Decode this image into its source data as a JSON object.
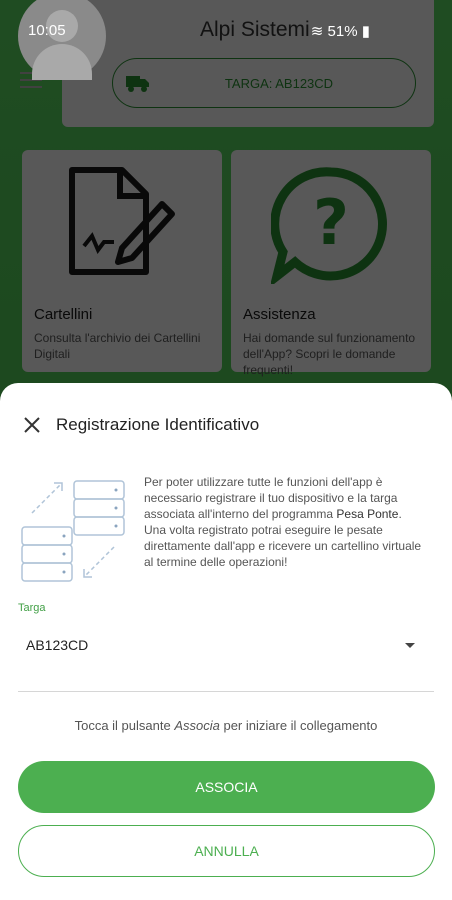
{
  "status_bar": {
    "time": "10:05",
    "battery": "51%"
  },
  "header": {
    "app_title": "Alpi Sistemi",
    "targa_label": "TARGA: AB123CD"
  },
  "cards": [
    {
      "title": "Cartellini",
      "description": "Consulta l'archivio dei Cartellini Digitali",
      "icon": "document-signature-icon"
    },
    {
      "title": "Assistenza",
      "description": "Hai domande sul funzionamento dell'App? Scopri le domande frequenti!",
      "icon": "question-bubble-icon"
    }
  ],
  "sheet": {
    "title": "Registrazione Identificativo",
    "info_text_1": "Per poter utilizzare tutte le funzioni dell'app è necessario registrare il tuo dispositivo e la targa associata all'interno del programma ",
    "info_bold": "Pesa Ponte",
    "info_text_2": ".",
    "info_text_3": "Una volta registrato potrai eseguire le pesate direttamente dall'app e ricevere un cartellino virtuale al termine delle operazioni!",
    "field_label": "Targa",
    "field_value": "AB123CD",
    "hint_prefix": "Tocca il pulsante ",
    "hint_em": "Associa",
    "hint_suffix": " per iniziare il collegamento",
    "associa_label": "ASSOCIA",
    "annulla_label": "ANNULLA"
  },
  "colors": {
    "primary": "#4caf50",
    "dark_green": "#2e7d32",
    "label_green": "#43a047"
  }
}
